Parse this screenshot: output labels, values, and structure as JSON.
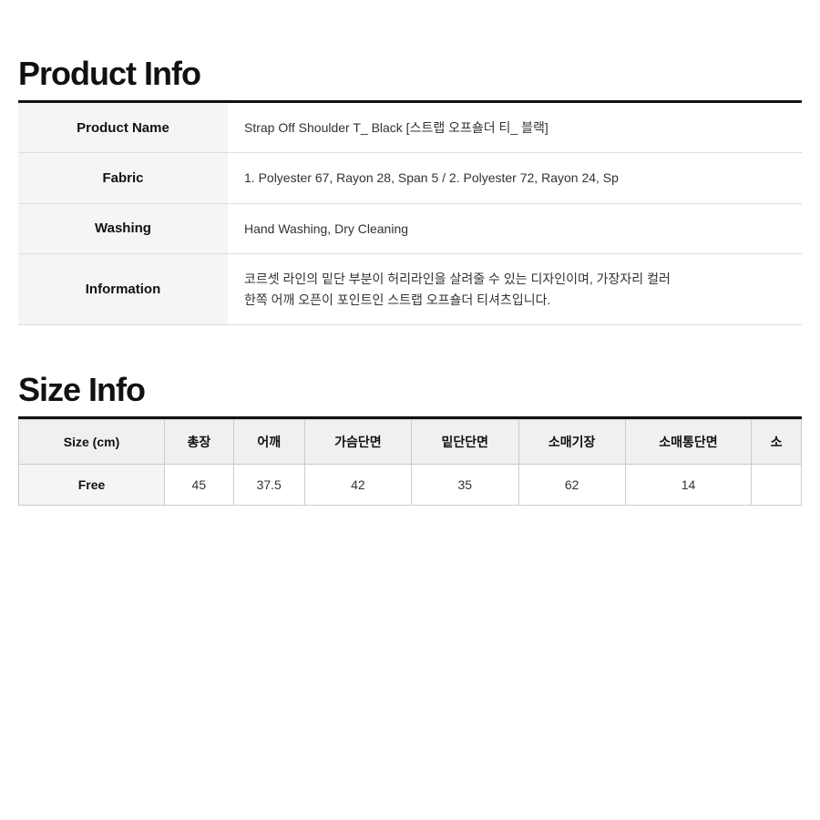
{
  "product_info_section": {
    "title": "Product Info",
    "divider": true,
    "rows": [
      {
        "label": "Product Name",
        "value": "Strap Off Shoulder T_ Black [스트랩 오프숄더 티_ 블랙]"
      },
      {
        "label": "Fabric",
        "value": "1. Polyester 67, Rayon 28, Span 5  /  2. Polyester 72, Rayon 24, Sp"
      },
      {
        "label": "Washing",
        "value": "Hand Washing, Dry Cleaning"
      },
      {
        "label": "Information",
        "value": "코르셋 라인의 밑단 부분이 허리라인을 살려줄 수 있는 디자인이며, 가장자리 컬러\n한쪽 어깨 오픈이 포인트인 스트랩 오프숄더 티셔츠입니다."
      }
    ]
  },
  "size_info_section": {
    "title": "Size Info",
    "divider": true,
    "header": {
      "label": "Size (cm)",
      "columns": [
        "총장",
        "어깨",
        "가슴단면",
        "밑단단면",
        "소매기장",
        "소매통단면",
        "소"
      ]
    },
    "rows": [
      {
        "size": "Free",
        "values": [
          "45",
          "37.5",
          "42",
          "35",
          "62",
          "14",
          ""
        ]
      }
    ]
  }
}
